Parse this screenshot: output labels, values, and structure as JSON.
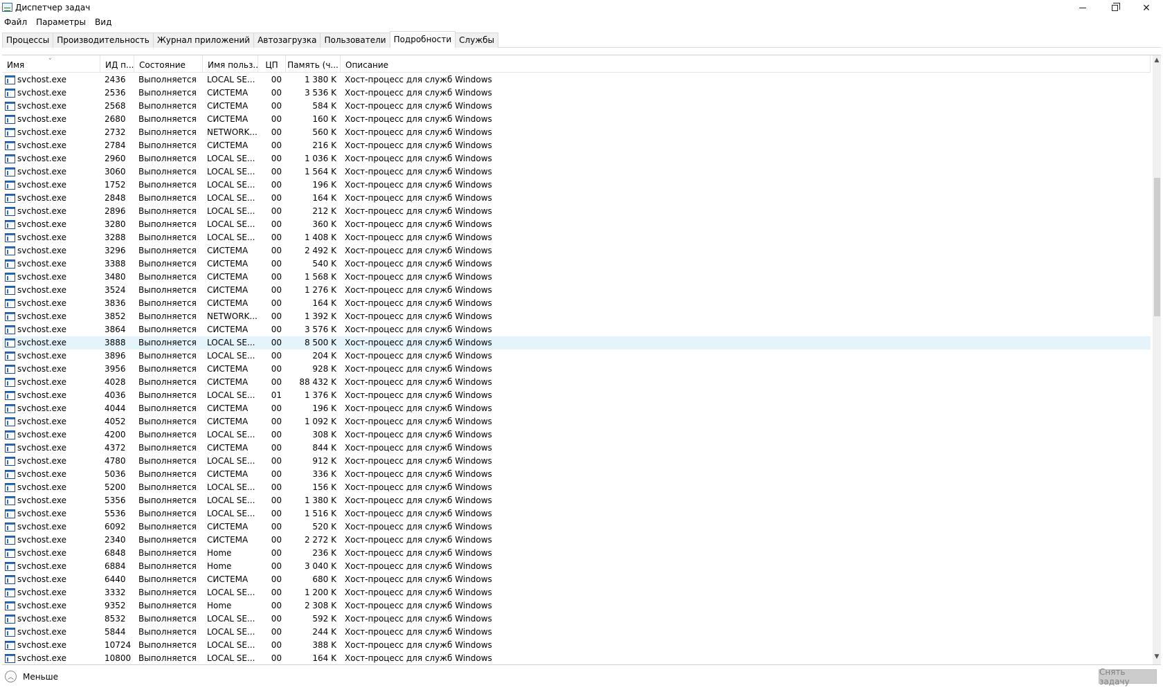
{
  "window": {
    "title": "Диспетчер задач"
  },
  "menu": [
    "Файл",
    "Параметры",
    "Вид"
  ],
  "tabs": [
    {
      "label": "Процессы",
      "active": false
    },
    {
      "label": "Производительность",
      "active": false
    },
    {
      "label": "Журнал приложений",
      "active": false
    },
    {
      "label": "Автозагрузка",
      "active": false
    },
    {
      "label": "Пользователи",
      "active": false
    },
    {
      "label": "Подробности",
      "active": true
    },
    {
      "label": "Службы",
      "active": false
    }
  ],
  "columns": {
    "name": "Имя",
    "pid": "ИД п...",
    "state": "Состояние",
    "user": "Имя польз...",
    "cpu": "ЦП",
    "mem": "Память (ч...",
    "desc": "Описание"
  },
  "selected_pid": "3888",
  "rows": [
    {
      "name": "svchost.exe",
      "pid": "2436",
      "state": "Выполняется",
      "user": "LOCAL SE...",
      "cpu": "00",
      "mem": "1 380 K",
      "desc": "Хост-процесс для служб Windows"
    },
    {
      "name": "svchost.exe",
      "pid": "2536",
      "state": "Выполняется",
      "user": "СИСТЕМА",
      "cpu": "00",
      "mem": "3 536 K",
      "desc": "Хост-процесс для служб Windows"
    },
    {
      "name": "svchost.exe",
      "pid": "2568",
      "state": "Выполняется",
      "user": "СИСТЕМА",
      "cpu": "00",
      "mem": "584 K",
      "desc": "Хост-процесс для служб Windows"
    },
    {
      "name": "svchost.exe",
      "pid": "2680",
      "state": "Выполняется",
      "user": "СИСТЕМА",
      "cpu": "00",
      "mem": "160 K",
      "desc": "Хост-процесс для служб Windows"
    },
    {
      "name": "svchost.exe",
      "pid": "2732",
      "state": "Выполняется",
      "user": "NETWORK...",
      "cpu": "00",
      "mem": "560 K",
      "desc": "Хост-процесс для служб Windows"
    },
    {
      "name": "svchost.exe",
      "pid": "2784",
      "state": "Выполняется",
      "user": "СИСТЕМА",
      "cpu": "00",
      "mem": "216 K",
      "desc": "Хост-процесс для служб Windows"
    },
    {
      "name": "svchost.exe",
      "pid": "2960",
      "state": "Выполняется",
      "user": "LOCAL SE...",
      "cpu": "00",
      "mem": "1 036 K",
      "desc": "Хост-процесс для служб Windows"
    },
    {
      "name": "svchost.exe",
      "pid": "3060",
      "state": "Выполняется",
      "user": "LOCAL SE...",
      "cpu": "00",
      "mem": "1 564 K",
      "desc": "Хост-процесс для служб Windows"
    },
    {
      "name": "svchost.exe",
      "pid": "1752",
      "state": "Выполняется",
      "user": "LOCAL SE...",
      "cpu": "00",
      "mem": "196 K",
      "desc": "Хост-процесс для служб Windows"
    },
    {
      "name": "svchost.exe",
      "pid": "2848",
      "state": "Выполняется",
      "user": "LOCAL SE...",
      "cpu": "00",
      "mem": "164 K",
      "desc": "Хост-процесс для служб Windows"
    },
    {
      "name": "svchost.exe",
      "pid": "2896",
      "state": "Выполняется",
      "user": "LOCAL SE...",
      "cpu": "00",
      "mem": "212 K",
      "desc": "Хост-процесс для служб Windows"
    },
    {
      "name": "svchost.exe",
      "pid": "3280",
      "state": "Выполняется",
      "user": "LOCAL SE...",
      "cpu": "00",
      "mem": "360 K",
      "desc": "Хост-процесс для служб Windows"
    },
    {
      "name": "svchost.exe",
      "pid": "3288",
      "state": "Выполняется",
      "user": "LOCAL SE...",
      "cpu": "00",
      "mem": "1 408 K",
      "desc": "Хост-процесс для служб Windows"
    },
    {
      "name": "svchost.exe",
      "pid": "3296",
      "state": "Выполняется",
      "user": "СИСТЕМА",
      "cpu": "00",
      "mem": "2 492 K",
      "desc": "Хост-процесс для служб Windows"
    },
    {
      "name": "svchost.exe",
      "pid": "3388",
      "state": "Выполняется",
      "user": "СИСТЕМА",
      "cpu": "00",
      "mem": "540 K",
      "desc": "Хост-процесс для служб Windows"
    },
    {
      "name": "svchost.exe",
      "pid": "3480",
      "state": "Выполняется",
      "user": "СИСТЕМА",
      "cpu": "00",
      "mem": "1 568 K",
      "desc": "Хост-процесс для служб Windows"
    },
    {
      "name": "svchost.exe",
      "pid": "3524",
      "state": "Выполняется",
      "user": "СИСТЕМА",
      "cpu": "00",
      "mem": "1 276 K",
      "desc": "Хост-процесс для служб Windows"
    },
    {
      "name": "svchost.exe",
      "pid": "3836",
      "state": "Выполняется",
      "user": "СИСТЕМА",
      "cpu": "00",
      "mem": "164 K",
      "desc": "Хост-процесс для служб Windows"
    },
    {
      "name": "svchost.exe",
      "pid": "3852",
      "state": "Выполняется",
      "user": "NETWORK...",
      "cpu": "00",
      "mem": "1 392 K",
      "desc": "Хост-процесс для служб Windows"
    },
    {
      "name": "svchost.exe",
      "pid": "3864",
      "state": "Выполняется",
      "user": "СИСТЕМА",
      "cpu": "00",
      "mem": "3 576 K",
      "desc": "Хост-процесс для служб Windows"
    },
    {
      "name": "svchost.exe",
      "pid": "3888",
      "state": "Выполняется",
      "user": "LOCAL SE...",
      "cpu": "00",
      "mem": "8 500 K",
      "desc": "Хост-процесс для служб Windows"
    },
    {
      "name": "svchost.exe",
      "pid": "3896",
      "state": "Выполняется",
      "user": "LOCAL SE...",
      "cpu": "00",
      "mem": "204 K",
      "desc": "Хост-процесс для служб Windows"
    },
    {
      "name": "svchost.exe",
      "pid": "3956",
      "state": "Выполняется",
      "user": "СИСТЕМА",
      "cpu": "00",
      "mem": "928 K",
      "desc": "Хост-процесс для служб Windows"
    },
    {
      "name": "svchost.exe",
      "pid": "4028",
      "state": "Выполняется",
      "user": "СИСТЕМА",
      "cpu": "00",
      "mem": "88 432 K",
      "desc": "Хост-процесс для служб Windows"
    },
    {
      "name": "svchost.exe",
      "pid": "4036",
      "state": "Выполняется",
      "user": "LOCAL SE...",
      "cpu": "01",
      "mem": "1 376 K",
      "desc": "Хост-процесс для служб Windows"
    },
    {
      "name": "svchost.exe",
      "pid": "4044",
      "state": "Выполняется",
      "user": "СИСТЕМА",
      "cpu": "00",
      "mem": "196 K",
      "desc": "Хост-процесс для служб Windows"
    },
    {
      "name": "svchost.exe",
      "pid": "4052",
      "state": "Выполняется",
      "user": "СИСТЕМА",
      "cpu": "00",
      "mem": "1 092 K",
      "desc": "Хост-процесс для служб Windows"
    },
    {
      "name": "svchost.exe",
      "pid": "4200",
      "state": "Выполняется",
      "user": "LOCAL SE...",
      "cpu": "00",
      "mem": "308 K",
      "desc": "Хост-процесс для служб Windows"
    },
    {
      "name": "svchost.exe",
      "pid": "4372",
      "state": "Выполняется",
      "user": "СИСТЕМА",
      "cpu": "00",
      "mem": "844 K",
      "desc": "Хост-процесс для служб Windows"
    },
    {
      "name": "svchost.exe",
      "pid": "4780",
      "state": "Выполняется",
      "user": "LOCAL SE...",
      "cpu": "00",
      "mem": "912 K",
      "desc": "Хост-процесс для служб Windows"
    },
    {
      "name": "svchost.exe",
      "pid": "5036",
      "state": "Выполняется",
      "user": "СИСТЕМА",
      "cpu": "00",
      "mem": "336 K",
      "desc": "Хост-процесс для служб Windows"
    },
    {
      "name": "svchost.exe",
      "pid": "5200",
      "state": "Выполняется",
      "user": "LOCAL SE...",
      "cpu": "00",
      "mem": "156 K",
      "desc": "Хост-процесс для служб Windows"
    },
    {
      "name": "svchost.exe",
      "pid": "5356",
      "state": "Выполняется",
      "user": "LOCAL SE...",
      "cpu": "00",
      "mem": "1 380 K",
      "desc": "Хост-процесс для служб Windows"
    },
    {
      "name": "svchost.exe",
      "pid": "5536",
      "state": "Выполняется",
      "user": "LOCAL SE...",
      "cpu": "00",
      "mem": "1 516 K",
      "desc": "Хост-процесс для служб Windows"
    },
    {
      "name": "svchost.exe",
      "pid": "6092",
      "state": "Выполняется",
      "user": "СИСТЕМА",
      "cpu": "00",
      "mem": "520 K",
      "desc": "Хост-процесс для служб Windows"
    },
    {
      "name": "svchost.exe",
      "pid": "2340",
      "state": "Выполняется",
      "user": "СИСТЕМА",
      "cpu": "00",
      "mem": "2 272 K",
      "desc": "Хост-процесс для служб Windows"
    },
    {
      "name": "svchost.exe",
      "pid": "6848",
      "state": "Выполняется",
      "user": "Home",
      "cpu": "00",
      "mem": "236 K",
      "desc": "Хост-процесс для служб Windows"
    },
    {
      "name": "svchost.exe",
      "pid": "6884",
      "state": "Выполняется",
      "user": "Home",
      "cpu": "00",
      "mem": "3 040 K",
      "desc": "Хост-процесс для служб Windows"
    },
    {
      "name": "svchost.exe",
      "pid": "6440",
      "state": "Выполняется",
      "user": "СИСТЕМА",
      "cpu": "00",
      "mem": "680 K",
      "desc": "Хост-процесс для служб Windows"
    },
    {
      "name": "svchost.exe",
      "pid": "3332",
      "state": "Выполняется",
      "user": "LOCAL SE...",
      "cpu": "00",
      "mem": "1 200 K",
      "desc": "Хост-процесс для служб Windows"
    },
    {
      "name": "svchost.exe",
      "pid": "9352",
      "state": "Выполняется",
      "user": "Home",
      "cpu": "00",
      "mem": "2 308 K",
      "desc": "Хост-процесс для служб Windows"
    },
    {
      "name": "svchost.exe",
      "pid": "8532",
      "state": "Выполняется",
      "user": "LOCAL SE...",
      "cpu": "00",
      "mem": "592 K",
      "desc": "Хост-процесс для служб Windows"
    },
    {
      "name": "svchost.exe",
      "pid": "5844",
      "state": "Выполняется",
      "user": "LOCAL SE...",
      "cpu": "00",
      "mem": "244 K",
      "desc": "Хост-процесс для служб Windows"
    },
    {
      "name": "svchost.exe",
      "pid": "10724",
      "state": "Выполняется",
      "user": "LOCAL SE...",
      "cpu": "00",
      "mem": "388 K",
      "desc": "Хост-процесс для служб Windows"
    },
    {
      "name": "svchost.exe",
      "pid": "10800",
      "state": "Выполняется",
      "user": "LOCAL SE...",
      "cpu": "00",
      "mem": "164 K",
      "desc": "Хост-процесс для служб Windows"
    }
  ],
  "footer": {
    "less_label": "Меньше",
    "end_task_label": "Снять задачу"
  }
}
